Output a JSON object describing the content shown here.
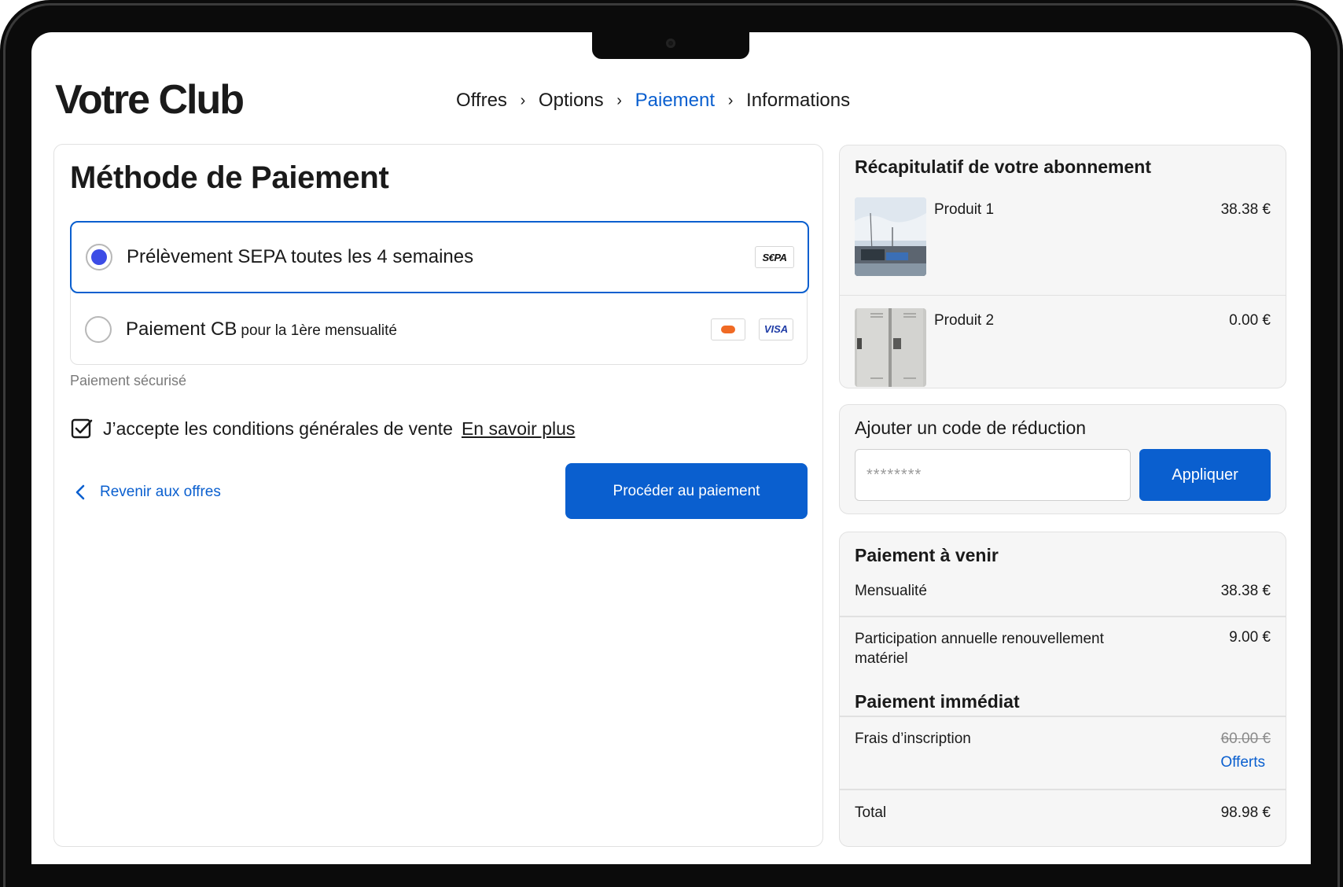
{
  "header": {
    "logo": "Votre Club",
    "breadcrumb": [
      {
        "label": "Offres",
        "active": false
      },
      {
        "label": "Options",
        "active": false
      },
      {
        "label": "Paiement",
        "active": true
      },
      {
        "label": "Informations",
        "active": false
      }
    ]
  },
  "payment": {
    "title": "Méthode de Paiement",
    "options": [
      {
        "label": "Prélèvement SEPA toutes les 4 semaines",
        "selected": true,
        "badge": "SEPA",
        "badge_text": "S€PA"
      },
      {
        "label": "Paiement CB",
        "sublabel": "pour la 1ère mensualité",
        "selected": false,
        "badges": [
          "mastercard",
          "VISA"
        ]
      }
    ],
    "secure_text": "Paiement sécurisé",
    "terms_text": "J’accepte les conditions générales de vente",
    "terms_link": "En savoir plus",
    "terms_checked": true,
    "back_label": "Revenir aux offres",
    "proceed_label": "Procéder au paiement"
  },
  "summary": {
    "title": "Récapitulatif de votre abonnement",
    "products": [
      {
        "name": "Produit 1",
        "price": "38.38 €"
      },
      {
        "name": "Produit 2",
        "price": "0.00 €"
      }
    ]
  },
  "discount": {
    "title": "Ajouter un code de réduction",
    "placeholder": "********",
    "apply_label": "Appliquer"
  },
  "upcoming": {
    "title": "Paiement à venir",
    "monthly_label": "Mensualité",
    "monthly_value": "38.38 €",
    "participation_label": "Participation annuelle renouvellement matériel",
    "participation_value": "9.00 €",
    "immediate_title": "Paiement immédiat",
    "registration_label": "Frais d’inscription",
    "registration_old": "60.00 €",
    "registration_offered": "Offerts",
    "total_label": "Total",
    "total_value": "98.98 €"
  },
  "colors": {
    "accent": "#0a5fcf",
    "radio_selected": "#3c4ce6",
    "panel_bg": "#f6f6f6"
  }
}
